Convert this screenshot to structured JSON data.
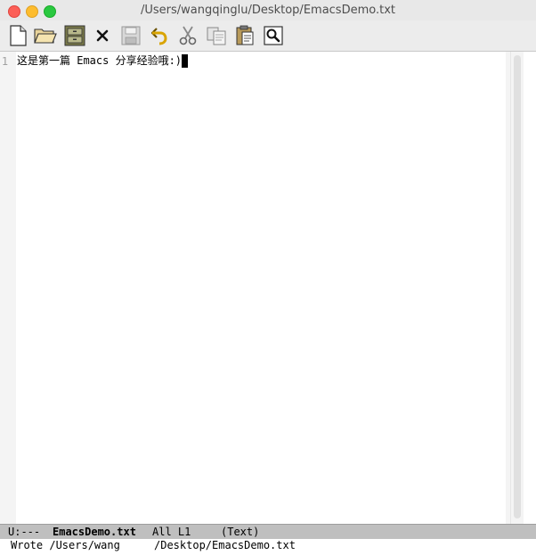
{
  "window": {
    "title": "/Users/wangqinglu/Desktop/EmacsDemo.txt"
  },
  "toolbar": {
    "buttons": [
      {
        "name": "new-file",
        "icon": "new-file-icon"
      },
      {
        "name": "open-file",
        "icon": "open-folder-icon"
      },
      {
        "name": "dired",
        "icon": "file-cabinet-icon"
      },
      {
        "name": "kill-buffer",
        "icon": "close-x-icon"
      },
      {
        "name": "save",
        "icon": "floppy-disk-icon"
      },
      {
        "name": "undo",
        "icon": "undo-arrow-icon"
      },
      {
        "name": "cut",
        "icon": "scissors-icon"
      },
      {
        "name": "copy",
        "icon": "copy-icon"
      },
      {
        "name": "paste",
        "icon": "clipboard-icon"
      },
      {
        "name": "search",
        "icon": "magnifier-icon"
      }
    ]
  },
  "editor": {
    "line_number": "1",
    "line_text": "这是第一篇 Emacs 分享经验哦:)"
  },
  "modeline": {
    "status": "U:---",
    "buffer_name": "EmacsDemo.txt",
    "position": "All L1",
    "mode": "(Text)"
  },
  "minibuffer": {
    "message_start": "Wrote /Users/wang",
    "message_end": "/Desktop/EmacsDemo.txt"
  },
  "colors": {
    "modeline_bg": "#bfbfbf",
    "toolbar_bg": "#ececec",
    "editor_bg": "#ffffff"
  }
}
